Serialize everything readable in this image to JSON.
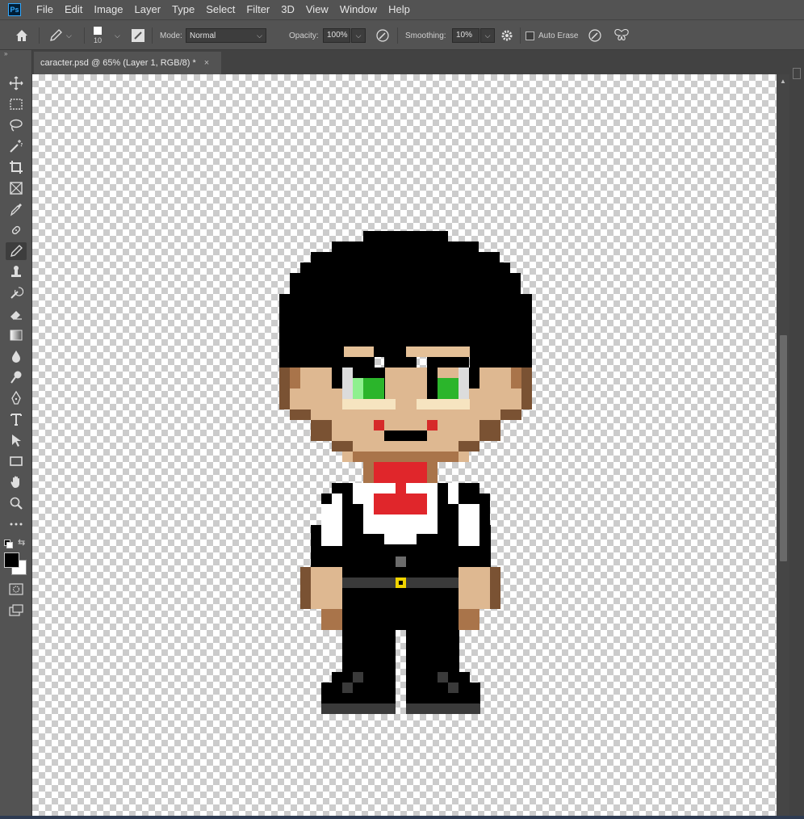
{
  "app": {
    "logo_text": "Ps"
  },
  "menu": [
    "File",
    "Edit",
    "Image",
    "Layer",
    "Type",
    "Select",
    "Filter",
    "3D",
    "View",
    "Window",
    "Help"
  ],
  "options": {
    "brush_size": "10",
    "mode_label": "Mode:",
    "mode_value": "Normal",
    "opacity_label": "Opacity:",
    "opacity_value": "100%",
    "smoothing_label": "Smoothing:",
    "smoothing_value": "10%",
    "auto_erase_label": "Auto Erase",
    "auto_erase_checked": false
  },
  "tools": [
    {
      "name": "move-tool",
      "icon": "move-icon"
    },
    {
      "name": "marquee-tool",
      "icon": "marquee-icon"
    },
    {
      "name": "lasso-tool",
      "icon": "lasso-icon"
    },
    {
      "name": "magic-wand-tool",
      "icon": "magic-wand-icon"
    },
    {
      "name": "crop-tool",
      "icon": "crop-icon"
    },
    {
      "name": "frame-tool",
      "icon": "frame-icon"
    },
    {
      "name": "eyedropper-tool",
      "icon": "eyedropper-icon"
    },
    {
      "name": "healing-brush-tool",
      "icon": "bandage-icon"
    },
    {
      "name": "pencil-tool",
      "icon": "pencil-icon",
      "active": true
    },
    {
      "name": "clone-stamp-tool",
      "icon": "stamp-icon"
    },
    {
      "name": "history-brush-tool",
      "icon": "history-brush-icon"
    },
    {
      "name": "eraser-tool",
      "icon": "eraser-icon"
    },
    {
      "name": "gradient-tool",
      "icon": "gradient-icon"
    },
    {
      "name": "blur-tool",
      "icon": "drop-icon"
    },
    {
      "name": "dodge-tool",
      "icon": "dodge-icon"
    },
    {
      "name": "pen-tool",
      "icon": "pen-icon"
    },
    {
      "name": "type-tool",
      "icon": "type-icon"
    },
    {
      "name": "path-selection-tool",
      "icon": "arrow-icon"
    },
    {
      "name": "rectangle-tool",
      "icon": "rectangle-icon"
    },
    {
      "name": "hand-tool",
      "icon": "hand-icon"
    },
    {
      "name": "zoom-tool",
      "icon": "zoom-icon"
    },
    {
      "name": "more-tools",
      "icon": "ellipsis-icon"
    }
  ],
  "colors": {
    "foreground": "#000000",
    "background": "#ffffff"
  },
  "document": {
    "tab_title": "caracter.psd @ 65% (Layer 1, RGB/8) *",
    "close_glyph": "×"
  }
}
